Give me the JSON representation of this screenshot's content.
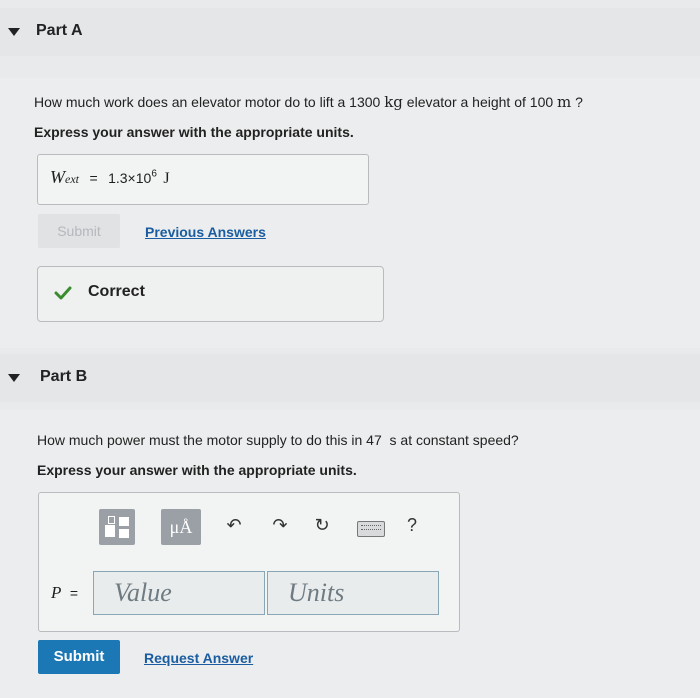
{
  "partA": {
    "title": "Part A",
    "question": {
      "before_mass": "How much work does an elevator motor do to lift a ",
      "mass": "1300",
      "mass_unit": "kg",
      "between": " elevator a height of ",
      "height": "100",
      "height_unit": "m",
      "after": " ?"
    },
    "instruction": "Express your answer with the appropriate units.",
    "answer": {
      "var": "W",
      "sub": "ext",
      "equals": "=",
      "mantissa": "1.3×10",
      "exponent": "6",
      "unit": "J"
    },
    "submit_label": "Submit",
    "previous_answers_label": "Previous Answers",
    "feedback": "Correct",
    "feedback_color": "#3a8d2e"
  },
  "partB": {
    "title": "Part B",
    "question": {
      "before_time": "How much power must the motor supply to do this in ",
      "time": "47",
      "after_time": "  s at constant speed?"
    },
    "instruction": "Express your answer with the appropriate units.",
    "toolbar": {
      "units_button": "μÅ",
      "help": "?"
    },
    "input": {
      "var": "P",
      "equals": "=",
      "value_placeholder": "Value",
      "units_placeholder": "Units"
    },
    "submit_label": "Submit",
    "request_answer_label": "Request Answer"
  },
  "colors": {
    "accent": "#1b78b5",
    "link": "#1a5da0"
  }
}
